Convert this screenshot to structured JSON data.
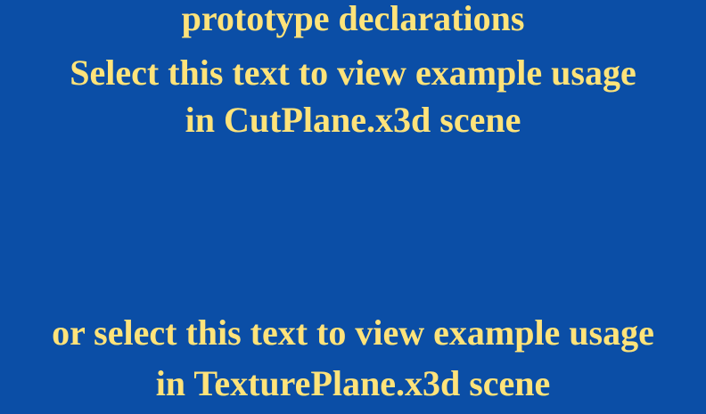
{
  "scene": {
    "background_color": "#0b4ea6",
    "text_color": "#ffe37a",
    "header": {
      "line1": "prototype declarations"
    },
    "cutplane_link": {
      "line1": "Select this text to view example usage",
      "line2": "in CutPlane.x3d scene"
    },
    "textureplane_link": {
      "line1": "or select this text to view example usage",
      "line2": "in TexturePlane.x3d scene"
    }
  }
}
